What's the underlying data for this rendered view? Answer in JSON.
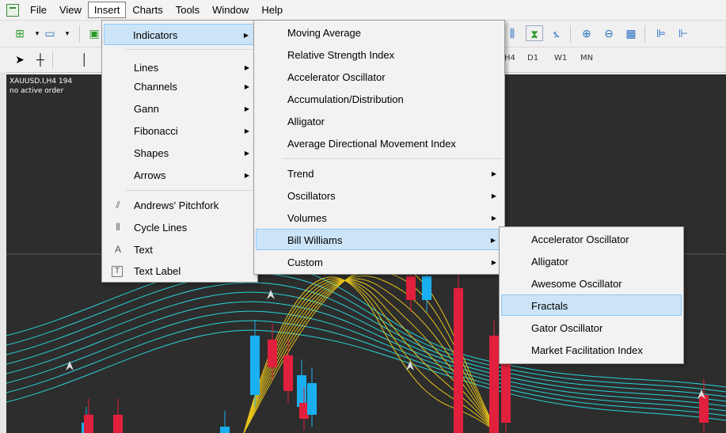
{
  "menubar": {
    "items": [
      {
        "label": "File"
      },
      {
        "label": "View"
      },
      {
        "label": "Insert"
      },
      {
        "label": "Charts"
      },
      {
        "label": "Tools"
      },
      {
        "label": "Window"
      },
      {
        "label": "Help"
      }
    ]
  },
  "toolbar": {
    "timeframes": [
      "H4",
      "D1",
      "W1",
      "MN"
    ]
  },
  "chart": {
    "title": "XAUUSD.I,H4  194",
    "status": "no active order",
    "colors": {
      "background": "#2d2d2d",
      "bull": "#1ab0f0",
      "bear": "#e0203c",
      "ma_a": "#29d4d8",
      "ma_b": "#e6c21a"
    }
  },
  "insert_menu": {
    "items": [
      {
        "label": "Indicators",
        "submenu": true,
        "highlighted": true
      },
      {
        "label": "Lines",
        "submenu": true
      },
      {
        "label": "Channels",
        "submenu": true
      },
      {
        "label": "Gann",
        "submenu": true
      },
      {
        "label": "Fibonacci",
        "submenu": true
      },
      {
        "label": "Shapes",
        "submenu": true
      },
      {
        "label": "Arrows",
        "submenu": true
      },
      {
        "label": "Andrews' Pitchfork",
        "icon": "pitchfork-icon"
      },
      {
        "label": "Cycle Lines",
        "icon": "cycle-lines-icon"
      },
      {
        "label": "Text",
        "icon": "text-icon"
      },
      {
        "label": "Text Label",
        "icon": "text-label-icon"
      }
    ]
  },
  "indicators_menu": {
    "items": [
      {
        "label": "Moving Average"
      },
      {
        "label": "Relative Strength Index"
      },
      {
        "label": "Accelerator Oscillator"
      },
      {
        "label": "Accumulation/Distribution"
      },
      {
        "label": "Alligator"
      },
      {
        "label": "Average Directional Movement Index"
      },
      {
        "label": "Trend",
        "submenu": true
      },
      {
        "label": "Oscillators",
        "submenu": true
      },
      {
        "label": "Volumes",
        "submenu": true
      },
      {
        "label": "Bill Williams",
        "submenu": true,
        "highlighted": true
      },
      {
        "label": "Custom",
        "submenu": true
      }
    ]
  },
  "bill_williams_menu": {
    "items": [
      {
        "label": "Accelerator Oscillator"
      },
      {
        "label": "Alligator"
      },
      {
        "label": "Awesome Oscillator"
      },
      {
        "label": "Fractals",
        "highlighted": true
      },
      {
        "label": "Gator Oscillator"
      },
      {
        "label": "Market Facilitation Index"
      }
    ]
  }
}
